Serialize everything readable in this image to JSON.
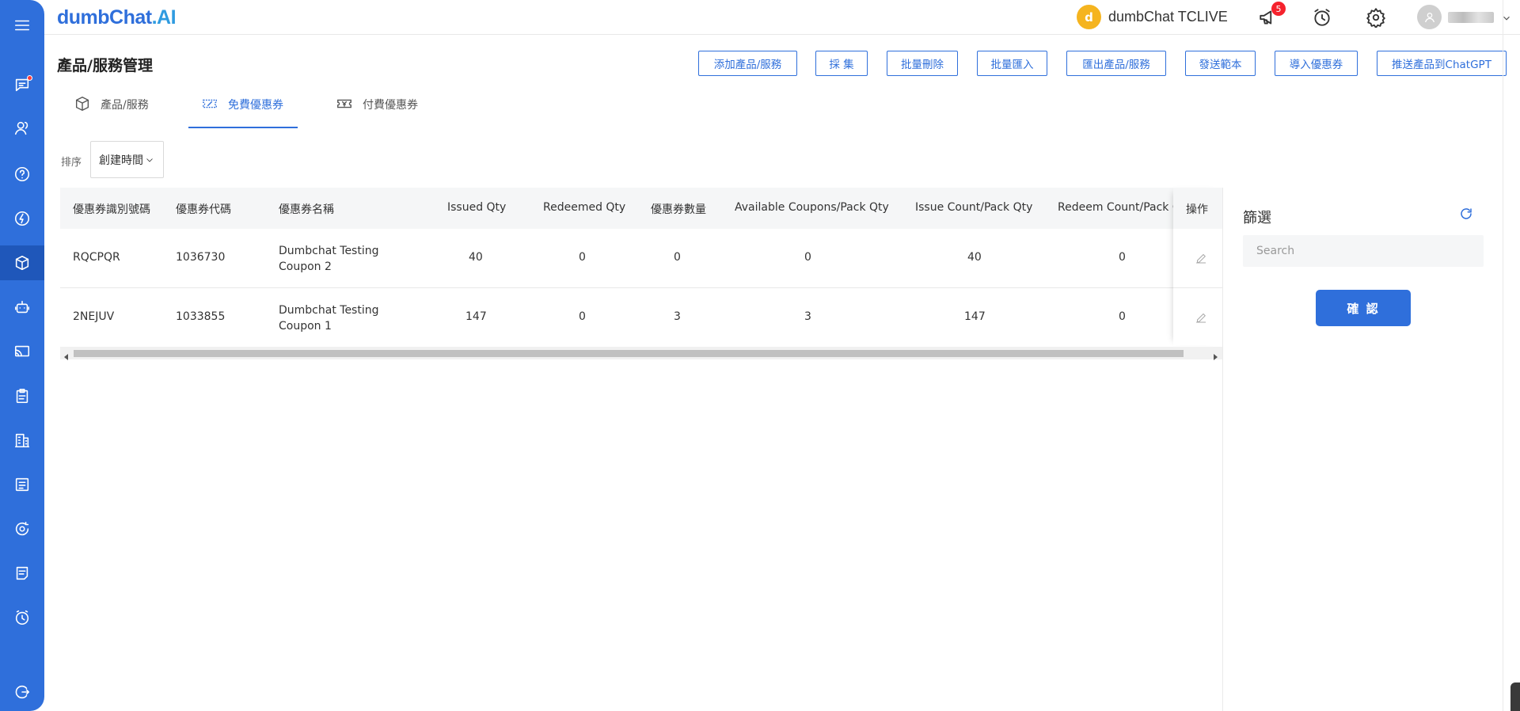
{
  "brand": {
    "part1": "dumbChat",
    "part2": ".AI"
  },
  "account": {
    "initial": "d",
    "name": "dumbChat TCLIVE"
  },
  "notifications": {
    "count": "5"
  },
  "sidebar": {
    "items": [
      {
        "icon": "menu-icon"
      },
      {
        "icon": "chat-icon"
      },
      {
        "icon": "contacts-icon"
      },
      {
        "icon": "help-icon"
      },
      {
        "icon": "lightning-icon"
      },
      {
        "icon": "product-box-icon"
      },
      {
        "icon": "robot-icon"
      },
      {
        "icon": "broadcast-icon"
      },
      {
        "icon": "clipboard-icon"
      },
      {
        "icon": "building-icon"
      },
      {
        "icon": "document-list-icon"
      },
      {
        "icon": "sync-icon"
      },
      {
        "icon": "notes-icon"
      },
      {
        "icon": "clock-icon"
      },
      {
        "icon": "logout-icon"
      }
    ]
  },
  "page": {
    "title": "產品/服務管理"
  },
  "toolbar": {
    "add": "添加產品/服務",
    "collect": "採 集",
    "batch_delete": "批量刪除",
    "batch_import": "批量匯入",
    "export": "匯出產品/服務",
    "send_template": "發送範本",
    "import_coupon": "導入優惠券",
    "push_chatgpt": "推送產品到ChatGPT"
  },
  "tabs": [
    {
      "label": "產品/服務",
      "icon": "box-icon"
    },
    {
      "label": "免費優惠券",
      "icon": "coupon-icon"
    },
    {
      "label": "付費優惠券",
      "icon": "paid-coupon-icon"
    }
  ],
  "sort": {
    "label": "排序",
    "value": "創建時間"
  },
  "table": {
    "columns": [
      "優惠券識別號碼",
      "優惠券代碼",
      "優惠券名稱",
      "Issued Qty",
      "Redeemed Qty",
      "優惠券數量",
      "Available Coupons/Pack Qty",
      "Issue Count/Pack Qty",
      "Redeem Count/Pack Q",
      "操作"
    ],
    "rows": [
      {
        "id": "RQCPQR",
        "code": "1036730",
        "name": "Dumbchat Testing Coupon 2",
        "issued": "40",
        "redeemed": "0",
        "qty": "0",
        "available": "0",
        "issue_count": "40",
        "redeem_count": "0"
      },
      {
        "id": "2NEJUV",
        "code": "1033855",
        "name": "Dumbchat Testing Coupon 1",
        "issued": "147",
        "redeemed": "0",
        "qty": "3",
        "available": "3",
        "issue_count": "147",
        "redeem_count": "0"
      }
    ]
  },
  "filter": {
    "title": "篩選",
    "search_placeholder": "Search",
    "confirm": "確 認"
  },
  "colors": {
    "primary": "#2f6fdb",
    "sidebar": "#2f6fdb",
    "badge": "#f5222d",
    "avatar": "#f5b41f"
  }
}
